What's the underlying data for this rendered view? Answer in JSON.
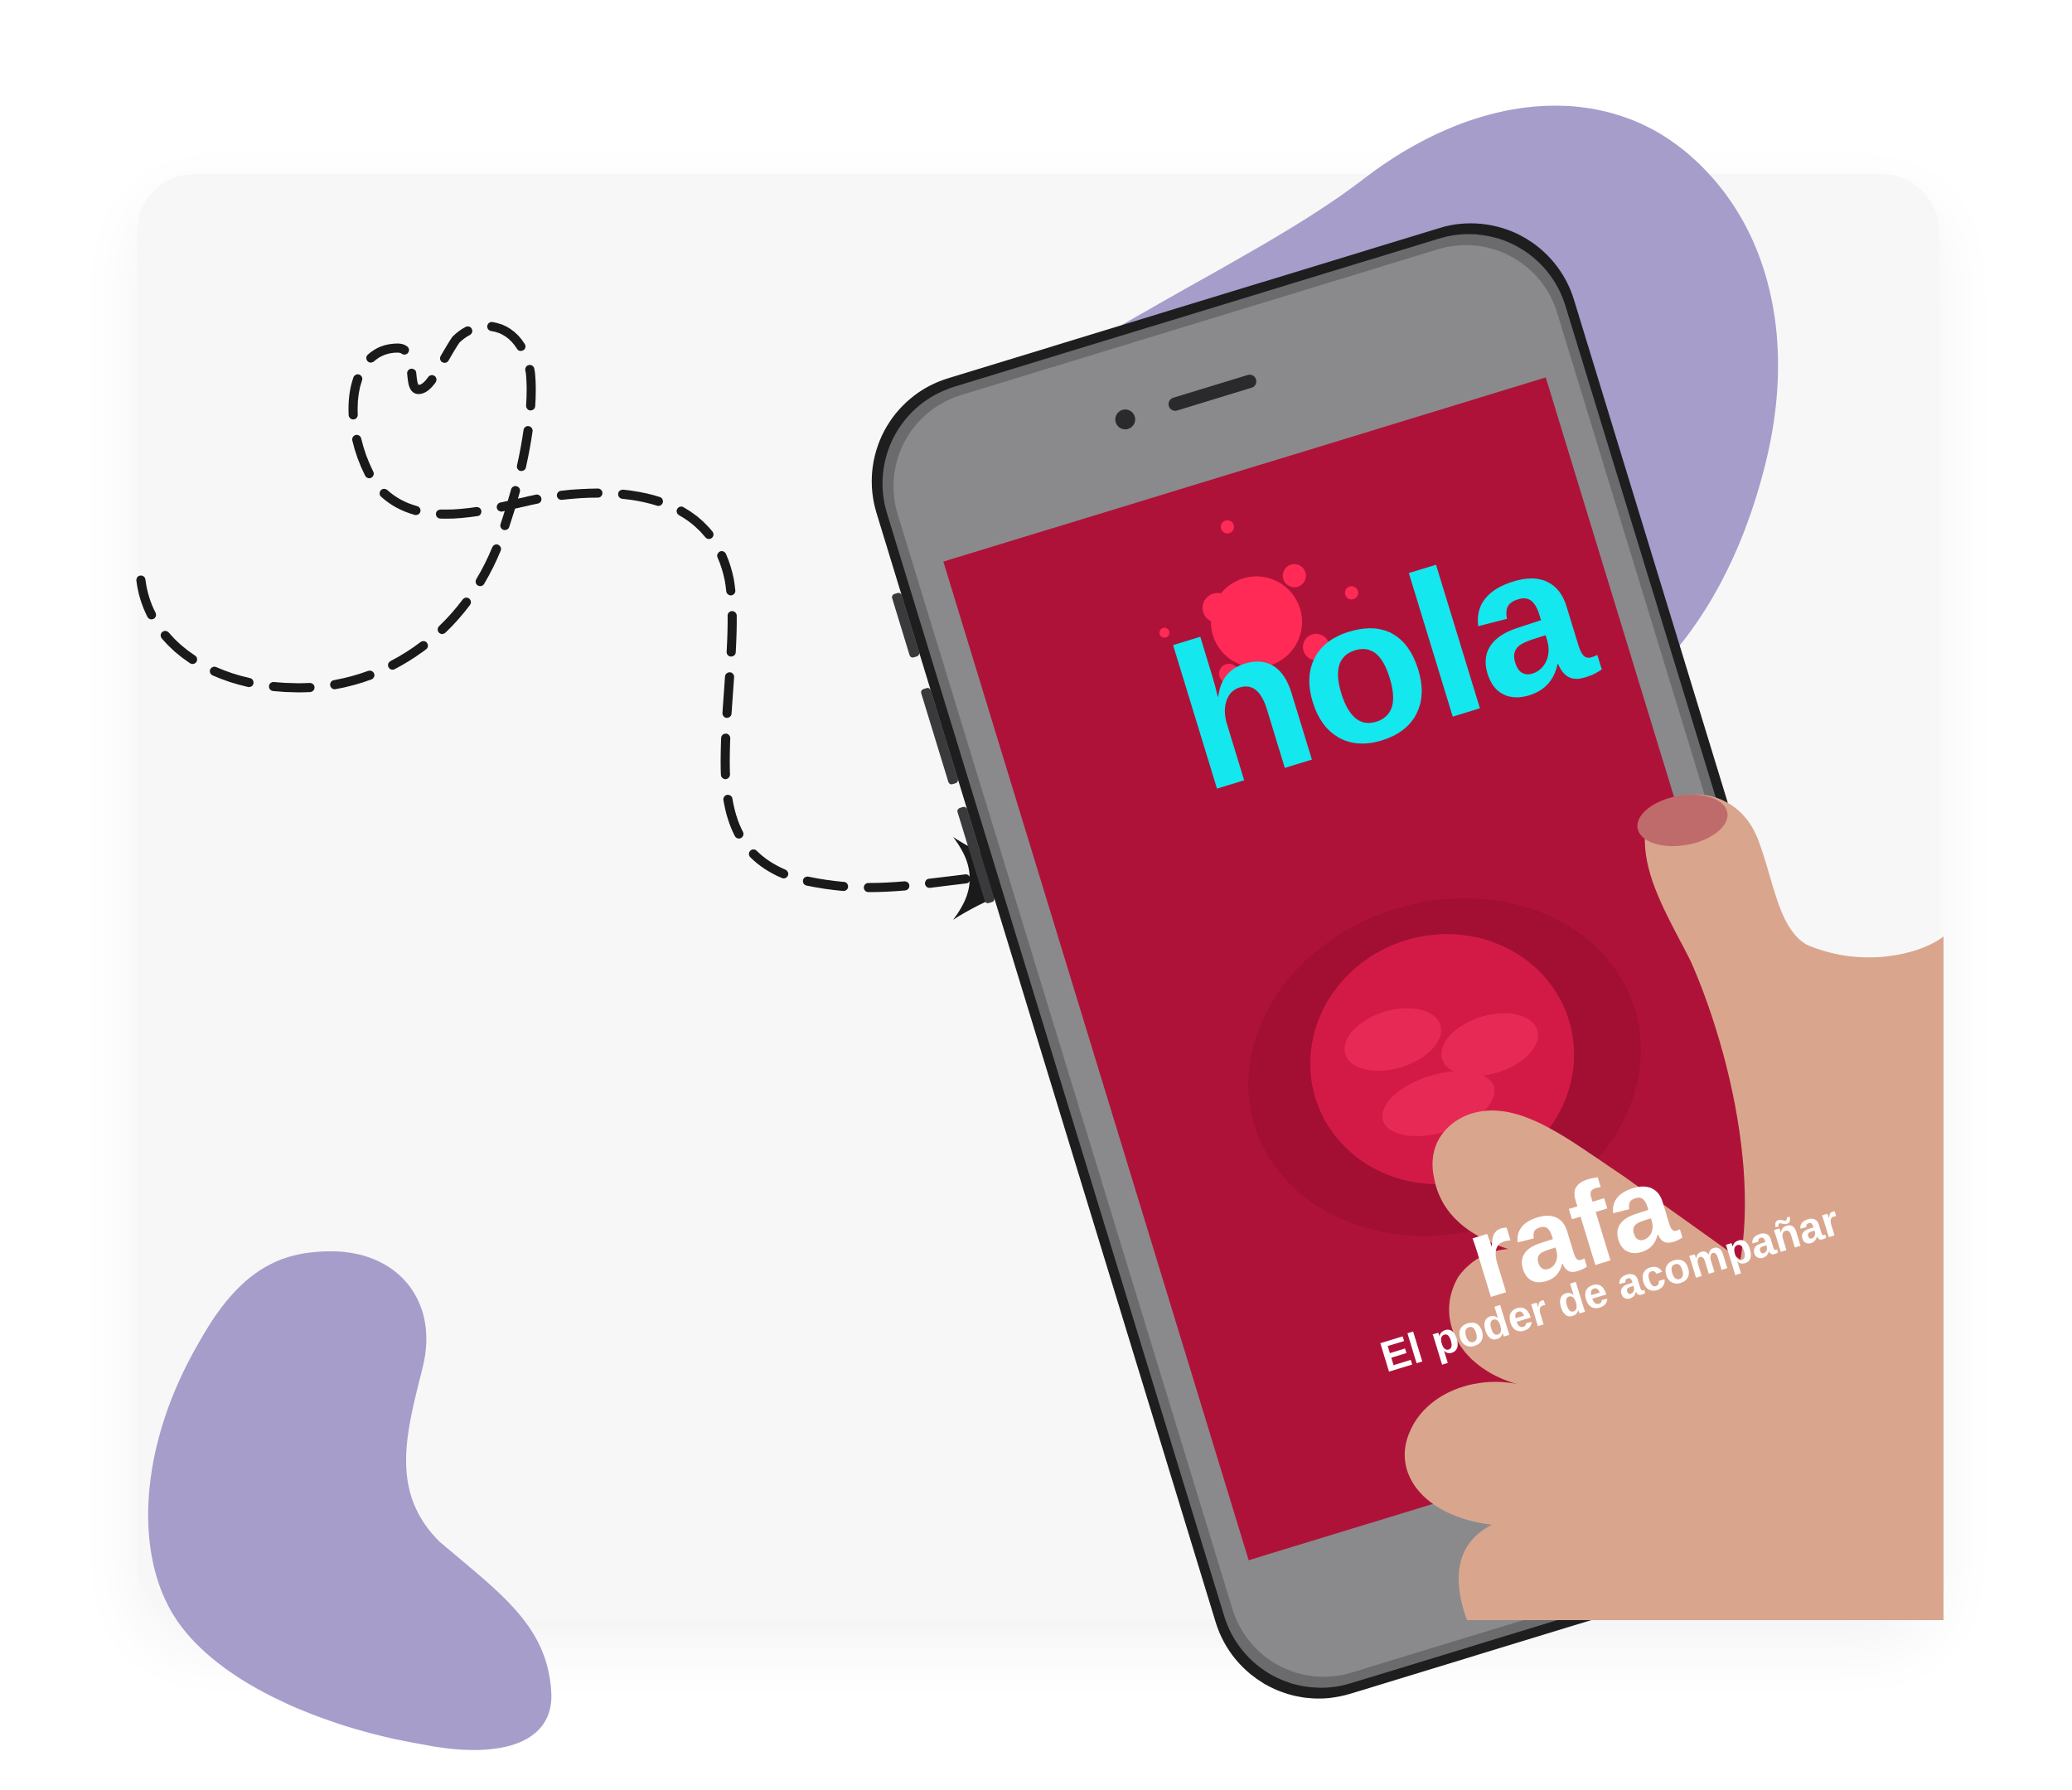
{
  "colors": {
    "background": "#ffffff",
    "card": "#f7f7f7",
    "blob": "#a69dcb",
    "screen": "#c0153f",
    "headline": "#14e7ee",
    "phone_body": "#3a3a3c",
    "path": "#1a1a1a"
  },
  "screen": {
    "headline": "hola",
    "brand": "rafa",
    "tagline": "El poder de acompañar"
  },
  "icons": {
    "arrow": "arrow-right-icon",
    "path": "dashed-loop-path"
  }
}
